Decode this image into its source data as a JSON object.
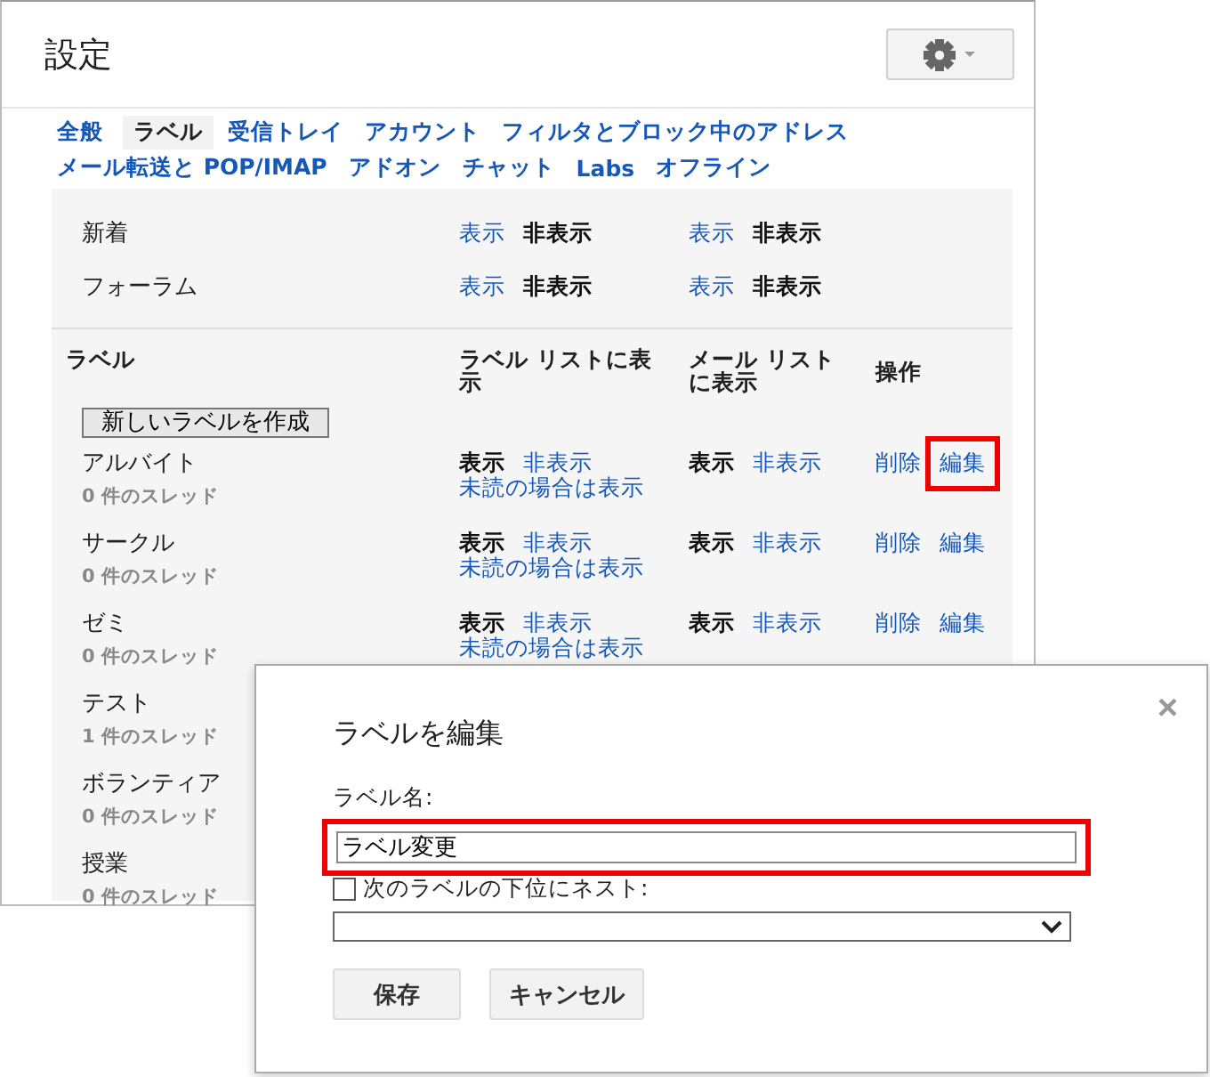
{
  "title": "設定",
  "tab_rows": [
    [
      {
        "label": "全般",
        "selected": false
      },
      {
        "label": "ラベル",
        "selected": true
      },
      {
        "label": "受信トレイ",
        "selected": false
      },
      {
        "label": "アカウント",
        "selected": false
      },
      {
        "label": "フィルタとブロック中のアドレス",
        "selected": false
      }
    ],
    [
      {
        "label": "メール転送と POP/IMAP",
        "selected": false
      },
      {
        "label": "アドオン",
        "selected": false
      },
      {
        "label": "チャット",
        "selected": false
      },
      {
        "label": "Labs",
        "selected": false
      },
      {
        "label": "オフライン",
        "selected": false
      }
    ]
  ],
  "system_labels": [
    {
      "name": "新着",
      "label_list": [
        {
          "label": "表示",
          "selected": false
        },
        {
          "label": "非表示",
          "selected": true
        }
      ],
      "mail_list": [
        {
          "label": "表示",
          "selected": false
        },
        {
          "label": "非表示",
          "selected": true
        }
      ]
    },
    {
      "name": "フォーラム",
      "label_list": [
        {
          "label": "表示",
          "selected": false
        },
        {
          "label": "非表示",
          "selected": true
        }
      ],
      "mail_list": [
        {
          "label": "表示",
          "selected": false
        },
        {
          "label": "非表示",
          "selected": true
        }
      ]
    }
  ],
  "columns": [
    "ラベル",
    "ラベル リストに表示",
    "メール リストに表示",
    "操作"
  ],
  "create_button": "新しいラベルを作成",
  "user_labels": [
    {
      "name": "アルバイト",
      "count": "0 件のスレッド",
      "label_list": [
        {
          "label": "表示",
          "selected": true
        },
        {
          "label": "非表示",
          "selected": false
        },
        {
          "label": "未読の場合は表示",
          "selected": false
        }
      ],
      "mail_list": [
        {
          "label": "表示",
          "selected": true
        },
        {
          "label": "非表示",
          "selected": false
        }
      ],
      "actions": [
        {
          "label": "削除",
          "highlighted": false
        },
        {
          "label": "編集",
          "highlighted": true
        }
      ]
    },
    {
      "name": "サークル",
      "count": "0 件のスレッド",
      "label_list": [
        {
          "label": "表示",
          "selected": true
        },
        {
          "label": "非表示",
          "selected": false
        },
        {
          "label": "未読の場合は表示",
          "selected": false
        }
      ],
      "mail_list": [
        {
          "label": "表示",
          "selected": true
        },
        {
          "label": "非表示",
          "selected": false
        }
      ],
      "actions": [
        {
          "label": "削除",
          "highlighted": false
        },
        {
          "label": "編集",
          "highlighted": false
        }
      ]
    },
    {
      "name": "ゼミ",
      "count": "0 件のスレッド",
      "label_list": [
        {
          "label": "表示",
          "selected": true
        },
        {
          "label": "非表示",
          "selected": false
        },
        {
          "label": "未読の場合は表示",
          "selected": false
        }
      ],
      "mail_list": [
        {
          "label": "表示",
          "selected": true
        },
        {
          "label": "非表示",
          "selected": false
        }
      ],
      "actions": [
        {
          "label": "削除",
          "highlighted": false
        },
        {
          "label": "編集",
          "highlighted": false
        }
      ]
    },
    {
      "name": "テスト",
      "count": "1 件のスレッド"
    },
    {
      "name": "ボランティア",
      "count": "0 件のスレッド"
    },
    {
      "name": "授業",
      "count": "0 件のスレッド"
    }
  ],
  "dialog": {
    "title": "ラベルを編集",
    "close": "×",
    "field_label": "ラベル名:",
    "field_value": "ラベル変更",
    "field_highlighted": true,
    "nest": {
      "label": "次のラベルの下位にネスト:",
      "checked": false
    },
    "buttons": [
      {
        "label": "保存",
        "kind": "primary"
      },
      {
        "label": "キャンセル",
        "kind": "secondary"
      }
    ]
  }
}
